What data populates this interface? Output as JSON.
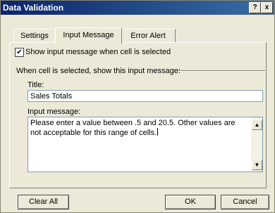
{
  "window": {
    "title": "Data Validation",
    "help_label": "?",
    "close_label": "x"
  },
  "tabs": [
    {
      "label": "Settings",
      "active": false
    },
    {
      "label": "Input Message",
      "active": true
    },
    {
      "label": "Error Alert",
      "active": false
    }
  ],
  "input_message": {
    "show_checkbox_checked": true,
    "show_checkbox_mark": "✔",
    "show_checkbox_label": "Show input message when cell is selected",
    "group_label": "When cell is selected, show this input message:",
    "title_label": "Title:",
    "title_value": "Sales Totals",
    "message_label": "Input message:",
    "message_value": "Please enter a value between .5 and 20.5. Other values are not acceptable for this range of cells."
  },
  "buttons": {
    "clear_all": "Clear All",
    "ok": "OK",
    "cancel": "Cancel"
  },
  "colors": {
    "titlebar": "#0a246a",
    "dialog_bg": "#ece9d8"
  }
}
